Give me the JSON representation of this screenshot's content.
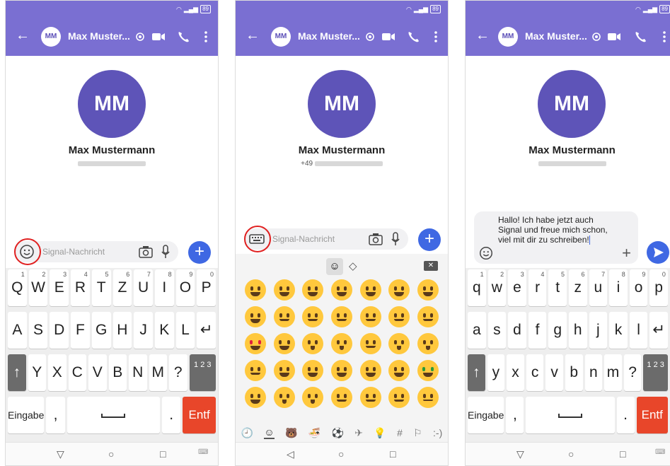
{
  "status": {
    "battery": "89",
    "network": "LTE"
  },
  "header": {
    "avatar_initials": "MM",
    "contact_title": "Max Muster..."
  },
  "contact": {
    "initials": "MM",
    "name": "Max Mustermann",
    "phone_prefix": "+49"
  },
  "composer": {
    "placeholder": "Signal-Nachricht",
    "message_draft": "Hallo! Ich habe jetzt auch Signal und freue mich schon, viel mit dir zu schreiben!"
  },
  "keyboard_upper": {
    "row1": [
      {
        "k": "Q",
        "n": "1"
      },
      {
        "k": "W",
        "n": "2"
      },
      {
        "k": "E",
        "n": "3"
      },
      {
        "k": "R",
        "n": "4"
      },
      {
        "k": "T",
        "n": "5"
      },
      {
        "k": "Z",
        "n": "6"
      },
      {
        "k": "U",
        "n": "7"
      },
      {
        "k": "I",
        "n": "8"
      },
      {
        "k": "O",
        "n": "9"
      },
      {
        "k": "P",
        "n": "0"
      }
    ],
    "row2": [
      "A",
      "S",
      "D",
      "F",
      "G",
      "H",
      "J",
      "K",
      "L"
    ],
    "row3": [
      "Y",
      "X",
      "C",
      "V",
      "B",
      "N",
      "M",
      "?"
    ]
  },
  "keyboard_lower": {
    "row1": [
      {
        "k": "q",
        "n": "1"
      },
      {
        "k": "w",
        "n": "2"
      },
      {
        "k": "e",
        "n": "3"
      },
      {
        "k": "r",
        "n": "4"
      },
      {
        "k": "t",
        "n": "5"
      },
      {
        "k": "z",
        "n": "6"
      },
      {
        "k": "u",
        "n": "7"
      },
      {
        "k": "i",
        "n": "8"
      },
      {
        "k": "o",
        "n": "9"
      },
      {
        "k": "p",
        "n": "0"
      }
    ],
    "row2": [
      "a",
      "s",
      "d",
      "f",
      "g",
      "h",
      "j",
      "k",
      "l"
    ],
    "row3": [
      "y",
      "x",
      "c",
      "v",
      "b",
      "n",
      "m",
      "?"
    ]
  },
  "keyboard_keys": {
    "enter_label": "Eingabe",
    "comma": ",",
    "period": ".",
    "delete_label": "Entf",
    "numbers_label": "1 2 3",
    "shift_glyph": "↑",
    "return_glyph": "↵"
  },
  "emoji_panel": {
    "emojis": [
      "😀",
      "😃",
      "😄",
      "😁",
      "😆",
      "😅",
      "🤣",
      "😂",
      "🙂",
      "🙃",
      "😉",
      "😊",
      "😇",
      "🥰",
      "😍",
      "🤩",
      "😘",
      "😗",
      "☺️",
      "😚",
      "😙",
      "🥲",
      "😋",
      "😛",
      "😜",
      "🤪",
      "😝",
      "🤑",
      "🤗",
      "🤭",
      "🤫",
      "🤔",
      "🤐",
      "🤨",
      "😐"
    ],
    "categories": [
      "🕘",
      "☺",
      "🐻",
      "🍜",
      "⚽",
      "✈",
      "💡",
      "#",
      "⚐",
      ":-)"
    ]
  },
  "navbar": {
    "back": "▽",
    "home": "○",
    "recents": "□",
    "keyboard": "⌨"
  },
  "colors": {
    "header": "#7a6fd2",
    "avatar": "#5e54b8",
    "accent": "#3f68e3",
    "delete": "#e8462a"
  }
}
